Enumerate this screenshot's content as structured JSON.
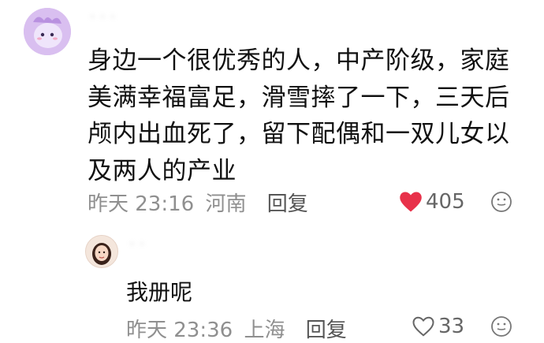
{
  "comment": {
    "username": "· · ·",
    "text": "身边一个很优秀的人，中产阶级，家庭美满幸福富足，滑雪摔了一下，三天后颅内出血死了，留下配偶和一双儿女以及两人的产业",
    "time": "昨天 23:16",
    "location": "河南",
    "reply_label": "回复",
    "likes": "405",
    "liked": true,
    "like_color": "#e8314a"
  },
  "reply": {
    "username": "· ·",
    "text": "我册呢",
    "time": "昨天 23:36",
    "location": "上海",
    "reply_label": "回复",
    "likes": "33",
    "liked": false
  }
}
